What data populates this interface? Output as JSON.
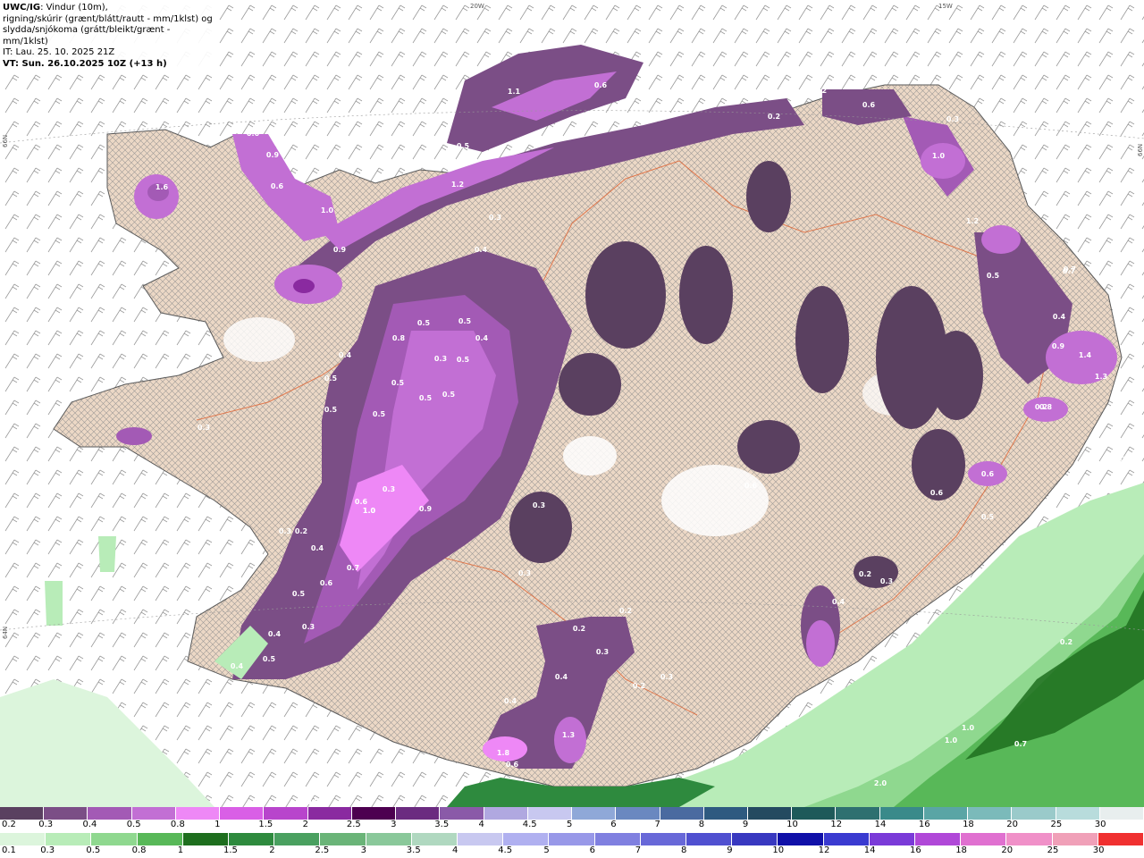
{
  "header": {
    "model": "UWC/IG",
    "line1": ": Vindur (10m),",
    "line2": "rigning/skúrir (grænt/blátt/rautt - mm/1klst) og",
    "line3": "slydda/snjókoma (grátt/bleikt/grænt - mm/1klst)",
    "line4": "IT: Lau. 25. 10. 2025 21Z",
    "line5": "VT: Sun. 26.10.2025 10Z (+13 h)"
  },
  "map_labels": {
    "lon_20w": "20W",
    "lon_15w": "15W",
    "lat_66n_left": "66N",
    "lat_66n_right": "66N",
    "lat_64n_left": "64N"
  },
  "precip_labels": [
    "1.1",
    "0.6",
    "0.2",
    "0.3",
    "0.3",
    "0.3",
    "0.2",
    "0.2",
    "0.6",
    "0.3",
    "0.6",
    "0.9",
    "0.6",
    "1.0",
    "0.9",
    "1.6",
    "1.2",
    "0.5",
    "0.4",
    "0.3",
    "0.4",
    "1.0",
    "0.3",
    "0.5",
    "0.8",
    "0.5",
    "0.4",
    "0.3",
    "0.5",
    "0.5",
    "0.5",
    "0.5",
    "0.5",
    "0.6",
    "0.5",
    "0.4",
    "0.5",
    "0.3",
    "1.0",
    "0.9",
    "0.7",
    "0.6",
    "0.4",
    "0.5",
    "0.4",
    "0.5",
    "0.4",
    "0.3",
    "0.2",
    "0.3",
    "0.2",
    "0.4",
    "0.3",
    "0.3",
    "0.2",
    "0.3",
    "1.8",
    "0.6",
    "1.3",
    "0.2",
    "0.4",
    "0.3",
    "0.2",
    "0.3",
    "1.4",
    "1.3",
    "1.2",
    "0.9",
    "0.8",
    "0.7",
    "0.5",
    "0.4",
    "0.6",
    "0.5",
    "0.6",
    "1.0",
    "0.2",
    "2.0",
    "1.0",
    "1.0",
    "0.7",
    "0.8",
    "0.7",
    "0.2",
    "0.6",
    "0.4",
    "0.7"
  ],
  "colorbar_snow": {
    "labels": [
      "0.2",
      "0.3",
      "0.4",
      "0.5",
      "0.8",
      "1",
      "1.5",
      "2",
      "2.5",
      "3",
      "3.5",
      "4",
      "4.5",
      "5",
      "6",
      "7",
      "8",
      "9",
      "10",
      "12",
      "14",
      "16",
      "18",
      "20",
      "25",
      "30"
    ],
    "colors": [
      "#5a4060",
      "#7b4e86",
      "#a35ab5",
      "#c26fd4",
      "#ee88f6",
      "#d95fe6",
      "#b845cc",
      "#8a2aa0",
      "#4d0050",
      "#6b2b80",
      "#8a5aa8",
      "#b0a8e0",
      "#c8c8f0",
      "#8fa8d8",
      "#6a88c0",
      "#4a6aa0",
      "#2e5a80",
      "#244a60",
      "#1e5a5a",
      "#2e7070",
      "#3a8a8a",
      "#5aa5a5",
      "#7bbaba",
      "#9acaca",
      "#b8dcdc",
      "#e8eeee"
    ]
  },
  "colorbar_rain": {
    "labels": [
      "0.1",
      "0.3",
      "0.5",
      "0.8",
      "1",
      "1.5",
      "2",
      "2.5",
      "3",
      "3.5",
      "4",
      "4.5",
      "5",
      "6",
      "7",
      "8",
      "9",
      "10",
      "12",
      "14",
      "16",
      "18",
      "20",
      "25",
      "30"
    ],
    "colors": [
      "#dcf5dc",
      "#b8ecb8",
      "#8fd88f",
      "#58b858",
      "#1e6e1e",
      "#2e8a3e",
      "#4aa060",
      "#6ab478",
      "#8ac89a",
      "#b0d8c0",
      "#c8c8f0",
      "#b0b0f0",
      "#9898e8",
      "#8080e0",
      "#6868d8",
      "#5050d0",
      "#3838c0",
      "#1010a8",
      "#3a3ad0",
      "#7a3ad8",
      "#b048d8",
      "#e070d0",
      "#f090c8",
      "#f0a0b8",
      "#f03030"
    ]
  }
}
